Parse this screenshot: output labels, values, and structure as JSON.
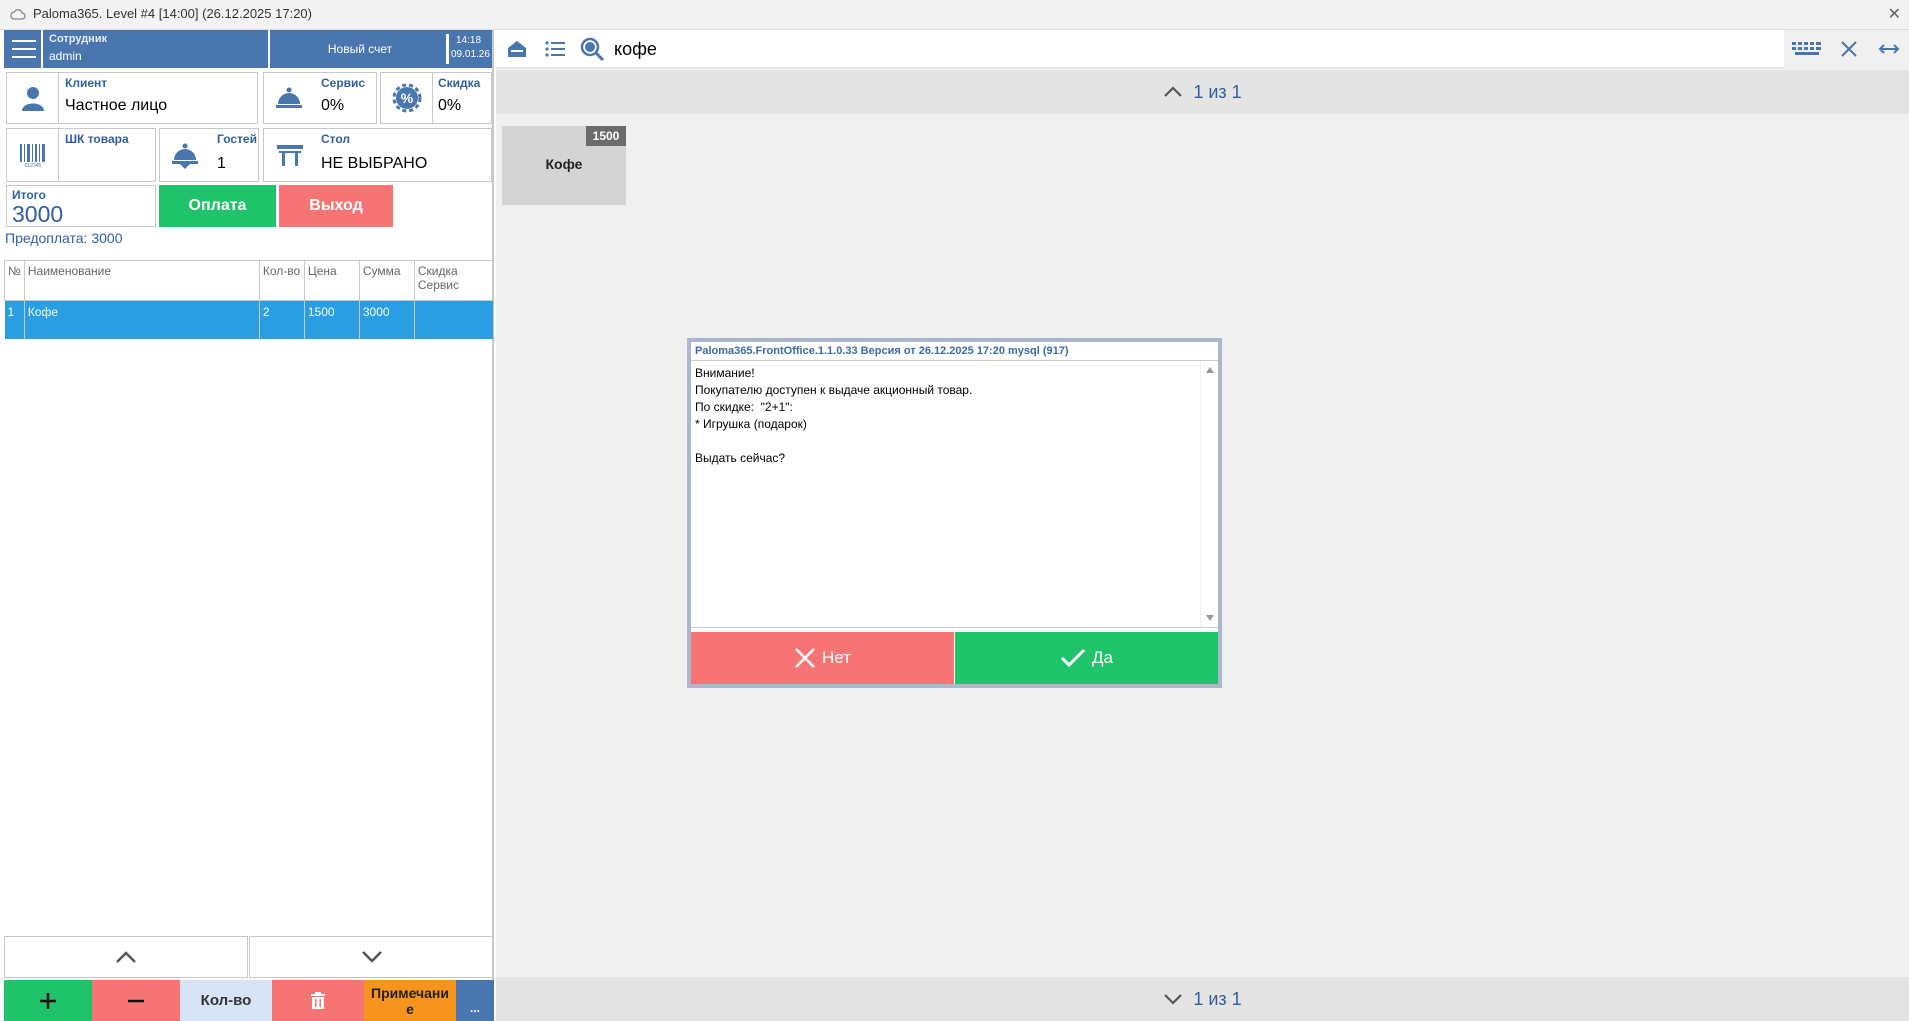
{
  "window": {
    "title": "Paloma365. Level #4 [14:00] (26.12.2025 17:20)"
  },
  "header": {
    "employee_label": "Сотрудник",
    "employee_name": "admin",
    "new_check": "Новый счет",
    "time": "14:18",
    "date": "09.01.26"
  },
  "client": {
    "label": "Клиент",
    "value": "Частное лицо"
  },
  "service": {
    "label": "Сервис",
    "value": "0%"
  },
  "discount": {
    "label": "Скидка",
    "value": "0%"
  },
  "barcode": {
    "label": "ШК товара",
    "value": ""
  },
  "guests": {
    "label": "Гостей",
    "value": "1"
  },
  "table": {
    "label": "Стол",
    "value": "НЕ ВЫБРАНО"
  },
  "total": {
    "label": "Итого",
    "value": "3000"
  },
  "actions": {
    "pay": "Оплата",
    "exit": "Выход"
  },
  "prepayment": "Предоплата: 3000",
  "cart": {
    "columns": [
      "№",
      "Наименование",
      "Кол-во",
      "Цена",
      "Сумма",
      "Скидка\nСервис"
    ],
    "rows": [
      {
        "num": "1",
        "name": "Кофе",
        "qty": "2",
        "price": "1500",
        "sum": "3000",
        "disc": ""
      }
    ]
  },
  "bottom_toolbar": {
    "qty": "Кол-во",
    "note": "Примечание",
    "more": "..."
  },
  "search": {
    "query": "кофе"
  },
  "pager": {
    "top": "1 из 1",
    "bottom": "1 из 1"
  },
  "products": [
    {
      "name": "Кофе",
      "price": "1500"
    }
  ],
  "dialog": {
    "title": "Paloma365.FrontOffice.1.1.0.33 Версия от 26.12.2025 17:20 mysql (917)",
    "message": "Внимание!\nПокупателю доступен к выдаче акционный товар.\nПо скидке:  \"2+1\":\n* Игрушка (подарок)\n\nВыдать сейчас?",
    "no": "Нет",
    "yes": "Да"
  },
  "colors": {
    "blue": "#4a76b0",
    "green": "#1ec36a",
    "red": "#f77474",
    "selected": "#2a9ee0",
    "orange": "#f7941d"
  }
}
